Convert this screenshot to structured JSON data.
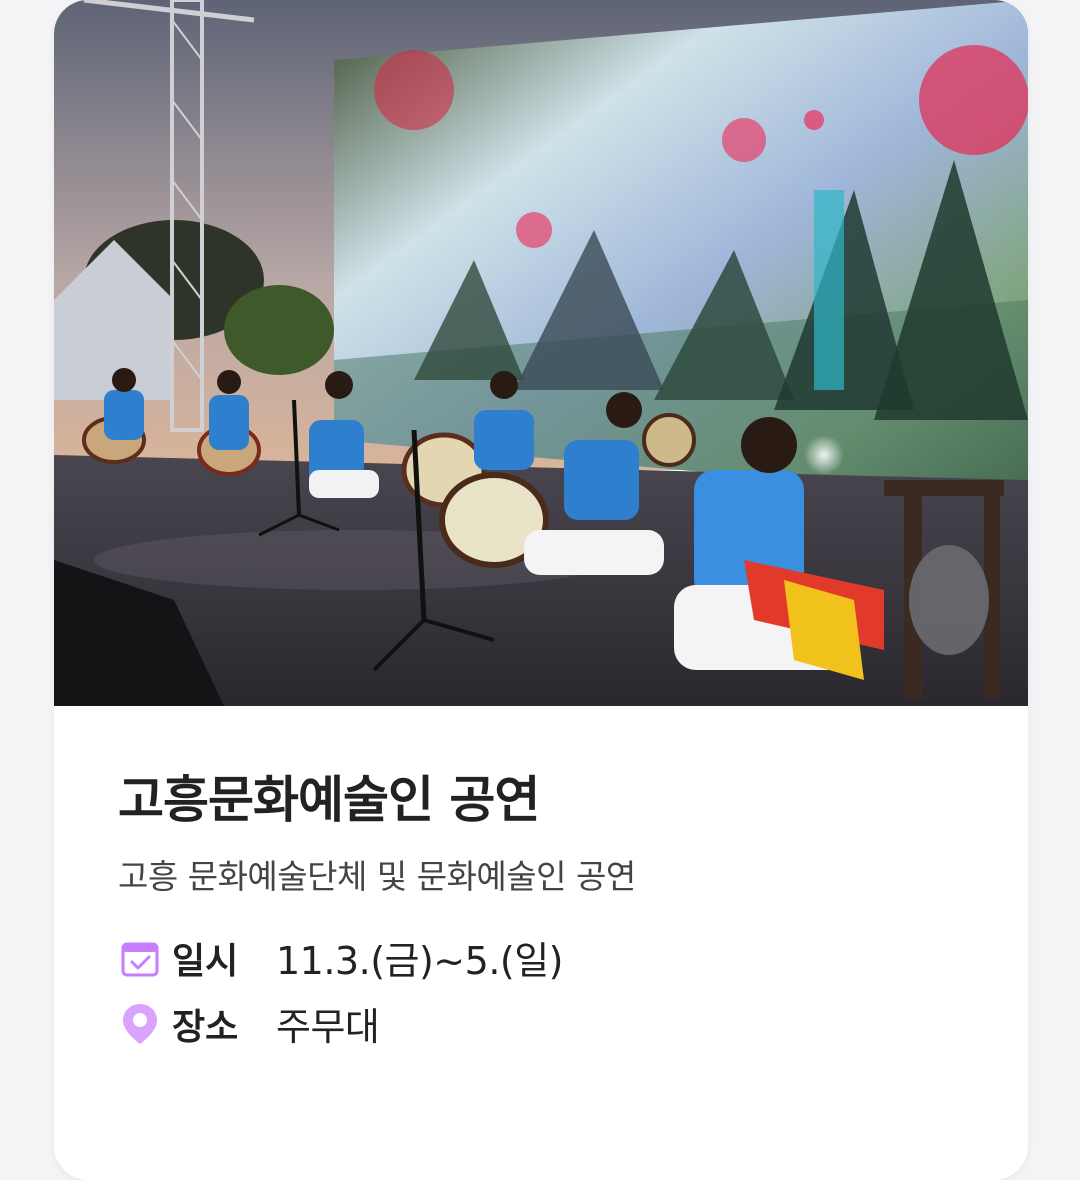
{
  "event": {
    "title": "고흥문화예술인 공연",
    "subtitle": "고흥 문화예술단체 및 문화예술인 공연",
    "date": {
      "icon": "calendar-check-icon",
      "label": "일시",
      "value": "11.3.(금)~5.(일)"
    },
    "place": {
      "icon": "location-pin-icon",
      "label": "장소",
      "value": "주무대"
    }
  },
  "colors": {
    "accent": "#c77dff",
    "text": "#222222",
    "subtext": "#444444"
  }
}
